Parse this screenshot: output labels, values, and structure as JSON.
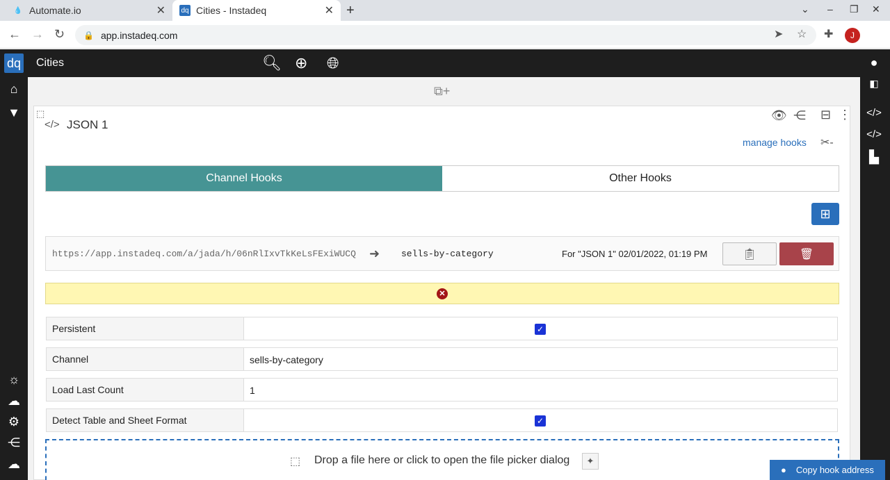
{
  "browser": {
    "tabs": [
      {
        "title": "Automate.io",
        "icon": "drop-icon"
      },
      {
        "title": "Cities - Instadeq",
        "icon": "dq-icon"
      }
    ],
    "url": "app.instadeq.com",
    "profile_initial": "J"
  },
  "app": {
    "logo": "dq",
    "title": "Cities"
  },
  "panel": {
    "title": "JSON 1",
    "manage_hooks_label": "manage hooks",
    "tabs": {
      "channel": "Channel Hooks",
      "other": "Other Hooks"
    },
    "hook": {
      "url": "https://app.instadeq.com/a/jada/h/06nRlIxvTkKeLsFExiWUCQ",
      "channel": "sells-by-category",
      "for_label": "For \"JSON 1\" 02/01/2022, 01:19 PM"
    },
    "form": {
      "persistent_label": "Persistent",
      "persistent_checked": true,
      "channel_label": "Channel",
      "channel_value": "sells-by-category",
      "load_last_count_label": "Load Last Count",
      "load_last_count_value": "1",
      "detect_format_label": "Detect Table and Sheet Format",
      "detect_format_checked": true
    },
    "dropzone_text": "Drop a file here or click to open the file picker dialog"
  },
  "copy_hook_label": "Copy hook address",
  "colors": {
    "tab_selected": "#469494",
    "primary": "#2a6fbb",
    "danger": "#a8434a",
    "warning_bg": "#fff7b3"
  }
}
